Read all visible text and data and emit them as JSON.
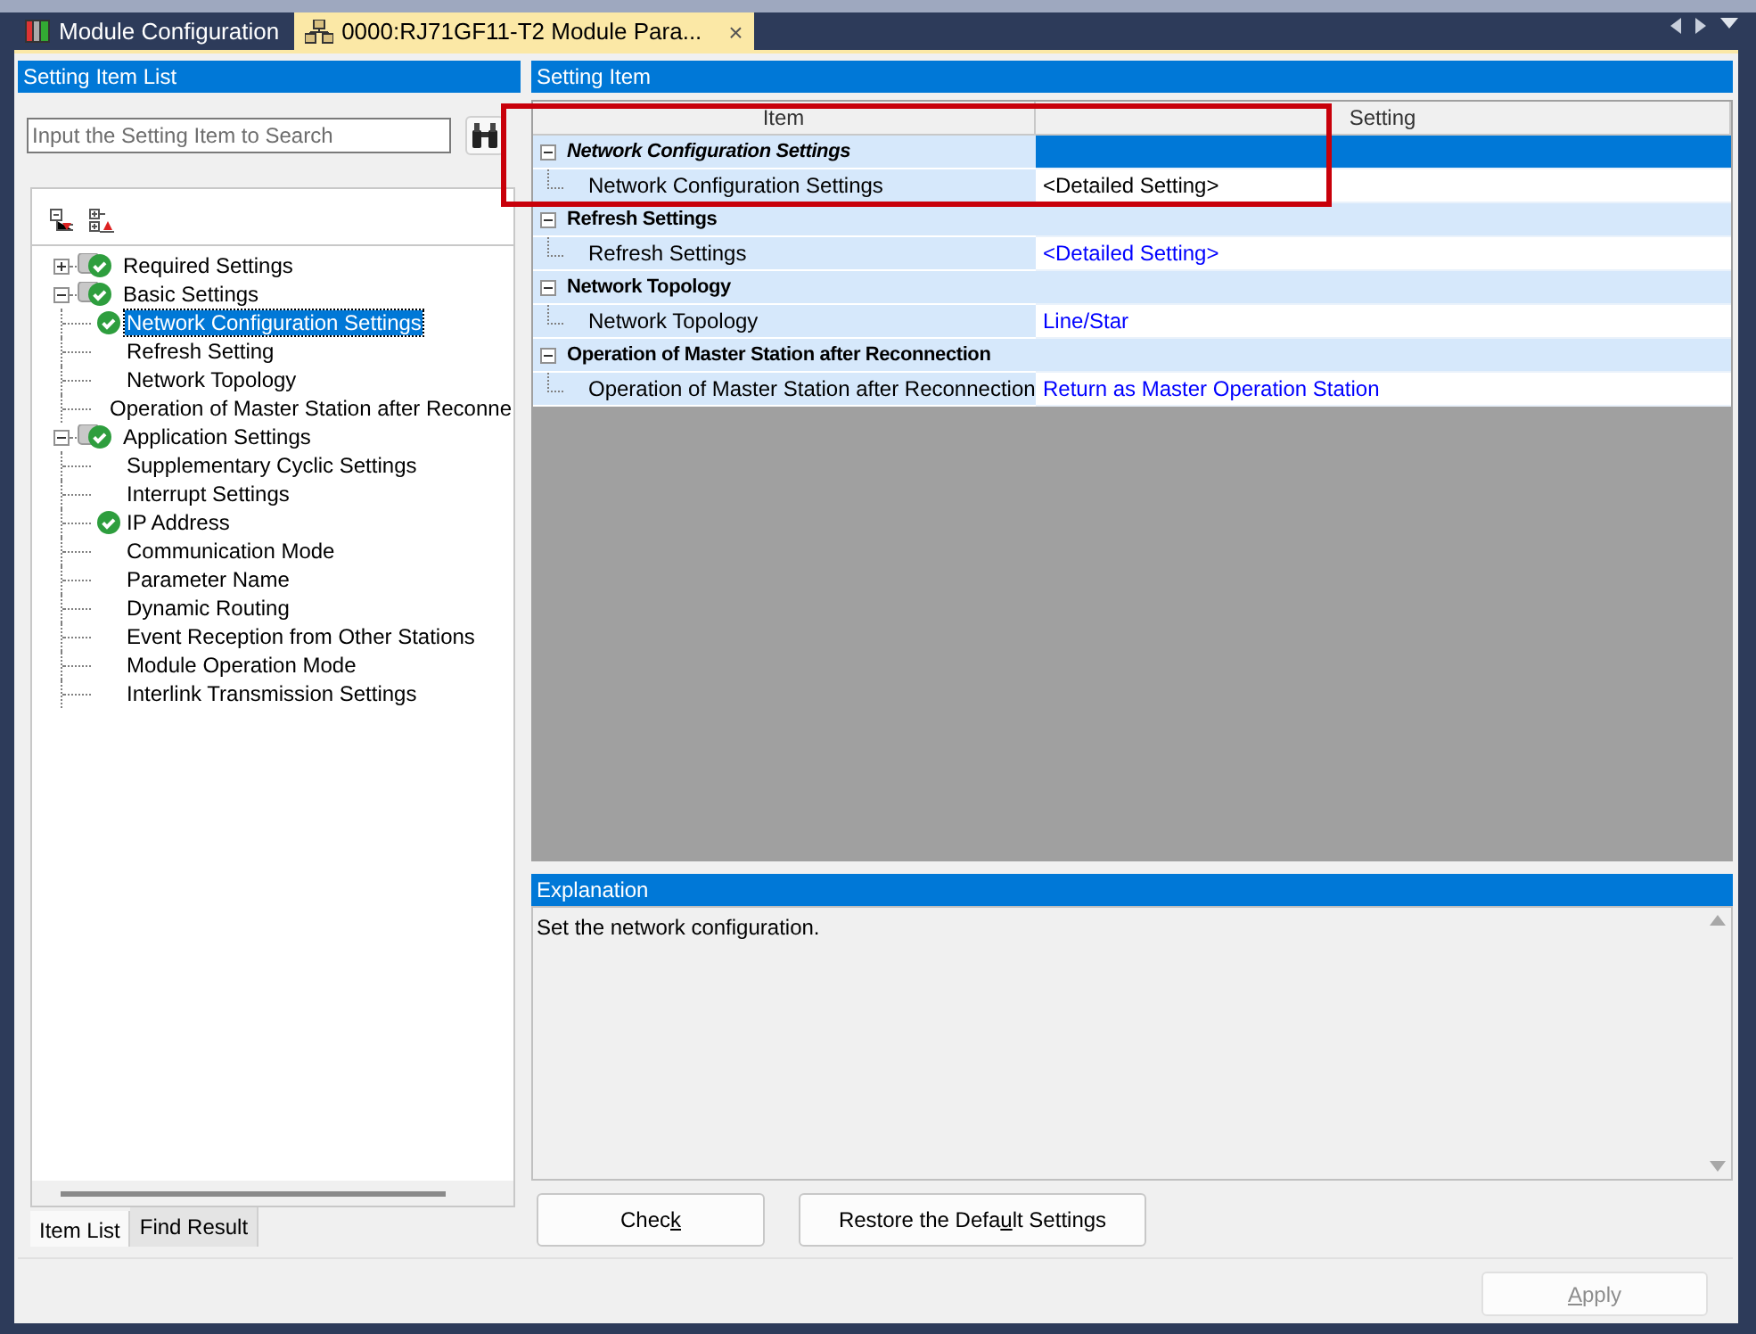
{
  "tabs": [
    {
      "label": "Module Configuration",
      "selected": false
    },
    {
      "label": "0000:RJ71GF11-T2 Module Para...",
      "selected": true
    }
  ],
  "tab_close": "×",
  "left_panel": {
    "title": "Setting Item List",
    "search": {
      "placeholder": "Input the Setting Item to Search"
    },
    "tree": [
      {
        "label": "Required Settings",
        "checked": true,
        "expanded": false,
        "selected": false
      },
      {
        "label": "Basic Settings",
        "checked": true,
        "expanded": true,
        "selected": false,
        "children": [
          {
            "label": "Network Configuration Settings",
            "checked": true,
            "selected": true
          },
          {
            "label": "Refresh Setting",
            "checked": false,
            "selected": false
          },
          {
            "label": "Network Topology",
            "checked": false,
            "selected": false
          },
          {
            "label": "Operation of Master Station after Reconne",
            "checked": false,
            "selected": false
          }
        ]
      },
      {
        "label": "Application Settings",
        "checked": true,
        "expanded": true,
        "selected": false,
        "children": [
          {
            "label": "Supplementary Cyclic Settings",
            "checked": false,
            "selected": false
          },
          {
            "label": "Interrupt Settings",
            "checked": false,
            "selected": false
          },
          {
            "label": "IP Address",
            "checked": true,
            "selected": false
          },
          {
            "label": "Communication Mode",
            "checked": false,
            "selected": false
          },
          {
            "label": "Parameter Name",
            "checked": false,
            "selected": false
          },
          {
            "label": "Dynamic Routing",
            "checked": false,
            "selected": false
          },
          {
            "label": "Event Reception from Other Stations",
            "checked": false,
            "selected": false
          },
          {
            "label": "Module Operation Mode",
            "checked": false,
            "selected": false
          },
          {
            "label": "Interlink Transmission Settings",
            "checked": false,
            "selected": false
          }
        ]
      }
    ],
    "bottom_tabs": [
      {
        "label": "Item List",
        "selected": true
      },
      {
        "label": "Find Result",
        "selected": false
      }
    ]
  },
  "setting_item": {
    "title": "Setting Item",
    "columns": [
      "Item",
      "Setting"
    ],
    "groups": [
      {
        "title": "Network Configuration Settings",
        "selected": true,
        "expanded": true,
        "rows": [
          {
            "item": "Network Configuration Settings",
            "setting": "<Detailed Setting>",
            "color": "#000000"
          }
        ]
      },
      {
        "title": "Refresh Settings",
        "selected": false,
        "expanded": true,
        "rows": [
          {
            "item": "Refresh Settings",
            "setting": "<Detailed Setting>",
            "color": "#0000ff"
          }
        ]
      },
      {
        "title": "Network Topology",
        "selected": false,
        "expanded": true,
        "rows": [
          {
            "item": "Network Topology",
            "setting": "Line/Star",
            "color": "#0000ff"
          }
        ]
      },
      {
        "title": "Operation of Master Station after Reconnection",
        "selected": false,
        "expanded": true,
        "rows": [
          {
            "item": "Operation of Master Station after Reconnection",
            "setting": "Return as Master Operation Station",
            "color": "#0000ff"
          }
        ]
      }
    ],
    "highlighted": true
  },
  "explanation": {
    "title": "Explanation",
    "text": "Set the network configuration."
  },
  "buttons": [
    {
      "before": "Chec",
      "key": "k",
      "disabled": false
    },
    {
      "before": "Restore the Defa",
      "key": "u",
      "after": "lt Settings",
      "disabled": false
    }
  ],
  "apply": {
    "key": "A",
    "after": "pply",
    "disabled": true
  }
}
